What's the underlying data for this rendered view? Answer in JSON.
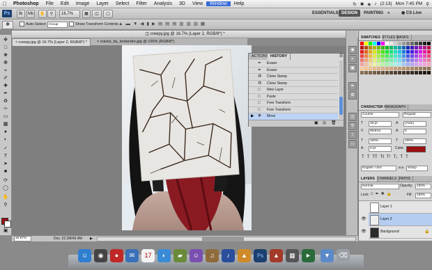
{
  "menubar": {
    "apple": "",
    "items": [
      "Photoshop",
      "File",
      "Edit",
      "Image",
      "Layer",
      "Select",
      "Filter",
      "Analysis",
      "3D",
      "View",
      "Window",
      "Help"
    ],
    "battery": "(2:13)",
    "clock": "Mon 7:45 PM"
  },
  "appbar": {
    "logo": "Ps",
    "zoom": "16.7%",
    "workspaces": [
      "ESSENTIALS",
      "DESIGN",
      "PAINTING"
    ],
    "more": "»",
    "cslive": "CS Live"
  },
  "options": {
    "auto_select_label": "Auto-Select:",
    "auto_select_value": "Group",
    "show_transform_label": "Show Transform Controls"
  },
  "document": {
    "window_title": "creepy.jpg @ 16.7% (Layer 2, RGB/8*) *",
    "tabs": [
      {
        "label": "creepy.jpg @ 16.7% (Layer 2, RGB/8*) *",
        "active": true
      },
      {
        "label": "cracks_by_lordandre.jpg @ 100% (RGB/8*)",
        "active": false
      }
    ],
    "zoom_status": "16.67%",
    "doc_status": "Doc: 22.2M/42.4M"
  },
  "history": {
    "tabs": [
      "ACTIONS",
      "HISTORY"
    ],
    "items": [
      {
        "label": "Eraser",
        "icon": "eraser-icon"
      },
      {
        "label": "Eraser",
        "icon": "eraser-icon"
      },
      {
        "label": "Clone Stamp",
        "icon": "clone-stamp-icon"
      },
      {
        "label": "Clone Stamp",
        "icon": "clone-stamp-icon"
      },
      {
        "label": "New Layer",
        "icon": "layer-icon"
      },
      {
        "label": "Paste",
        "icon": "paste-icon"
      },
      {
        "label": "Free Transform",
        "icon": "transform-icon"
      },
      {
        "label": "Free Transform",
        "icon": "transform-icon"
      },
      {
        "label": "Move",
        "icon": "move-icon"
      }
    ],
    "selected_index": 8
  },
  "swatches": {
    "tabs": [
      "SWATCHES",
      "STYLES",
      "MASKS"
    ]
  },
  "character": {
    "tabs": [
      "CHARACTER",
      "PARAGRAPH"
    ],
    "font_family": "Courier",
    "font_style": "Regular",
    "size": "18 pt",
    "leading": "(Auto)",
    "kerning": "Metrics",
    "tracking": "0",
    "vscale": "100%",
    "hscale": "100%",
    "baseline": "0 pt",
    "color_label": "Color:",
    "color": "#9b1111",
    "language": "English: USA",
    "aa_label": "a a",
    "aa": "Sharp"
  },
  "layers": {
    "tabs": [
      "LAYERS",
      "CHANNELS",
      "PATHS"
    ],
    "blend": "Normal",
    "opacity_label": "Opacity:",
    "opacity": "100%",
    "lock_label": "Lock:",
    "fill_label": "Fill:",
    "fill": "100%",
    "items": [
      {
        "name": "Layer 1",
        "visible": false,
        "selected": false
      },
      {
        "name": "Layer 2",
        "visible": true,
        "selected": true
      },
      {
        "name": "Background",
        "visible": true,
        "selected": false
      }
    ]
  },
  "colors": {
    "foreground": "#9b0f0f",
    "accent": "#3a6bd6"
  }
}
